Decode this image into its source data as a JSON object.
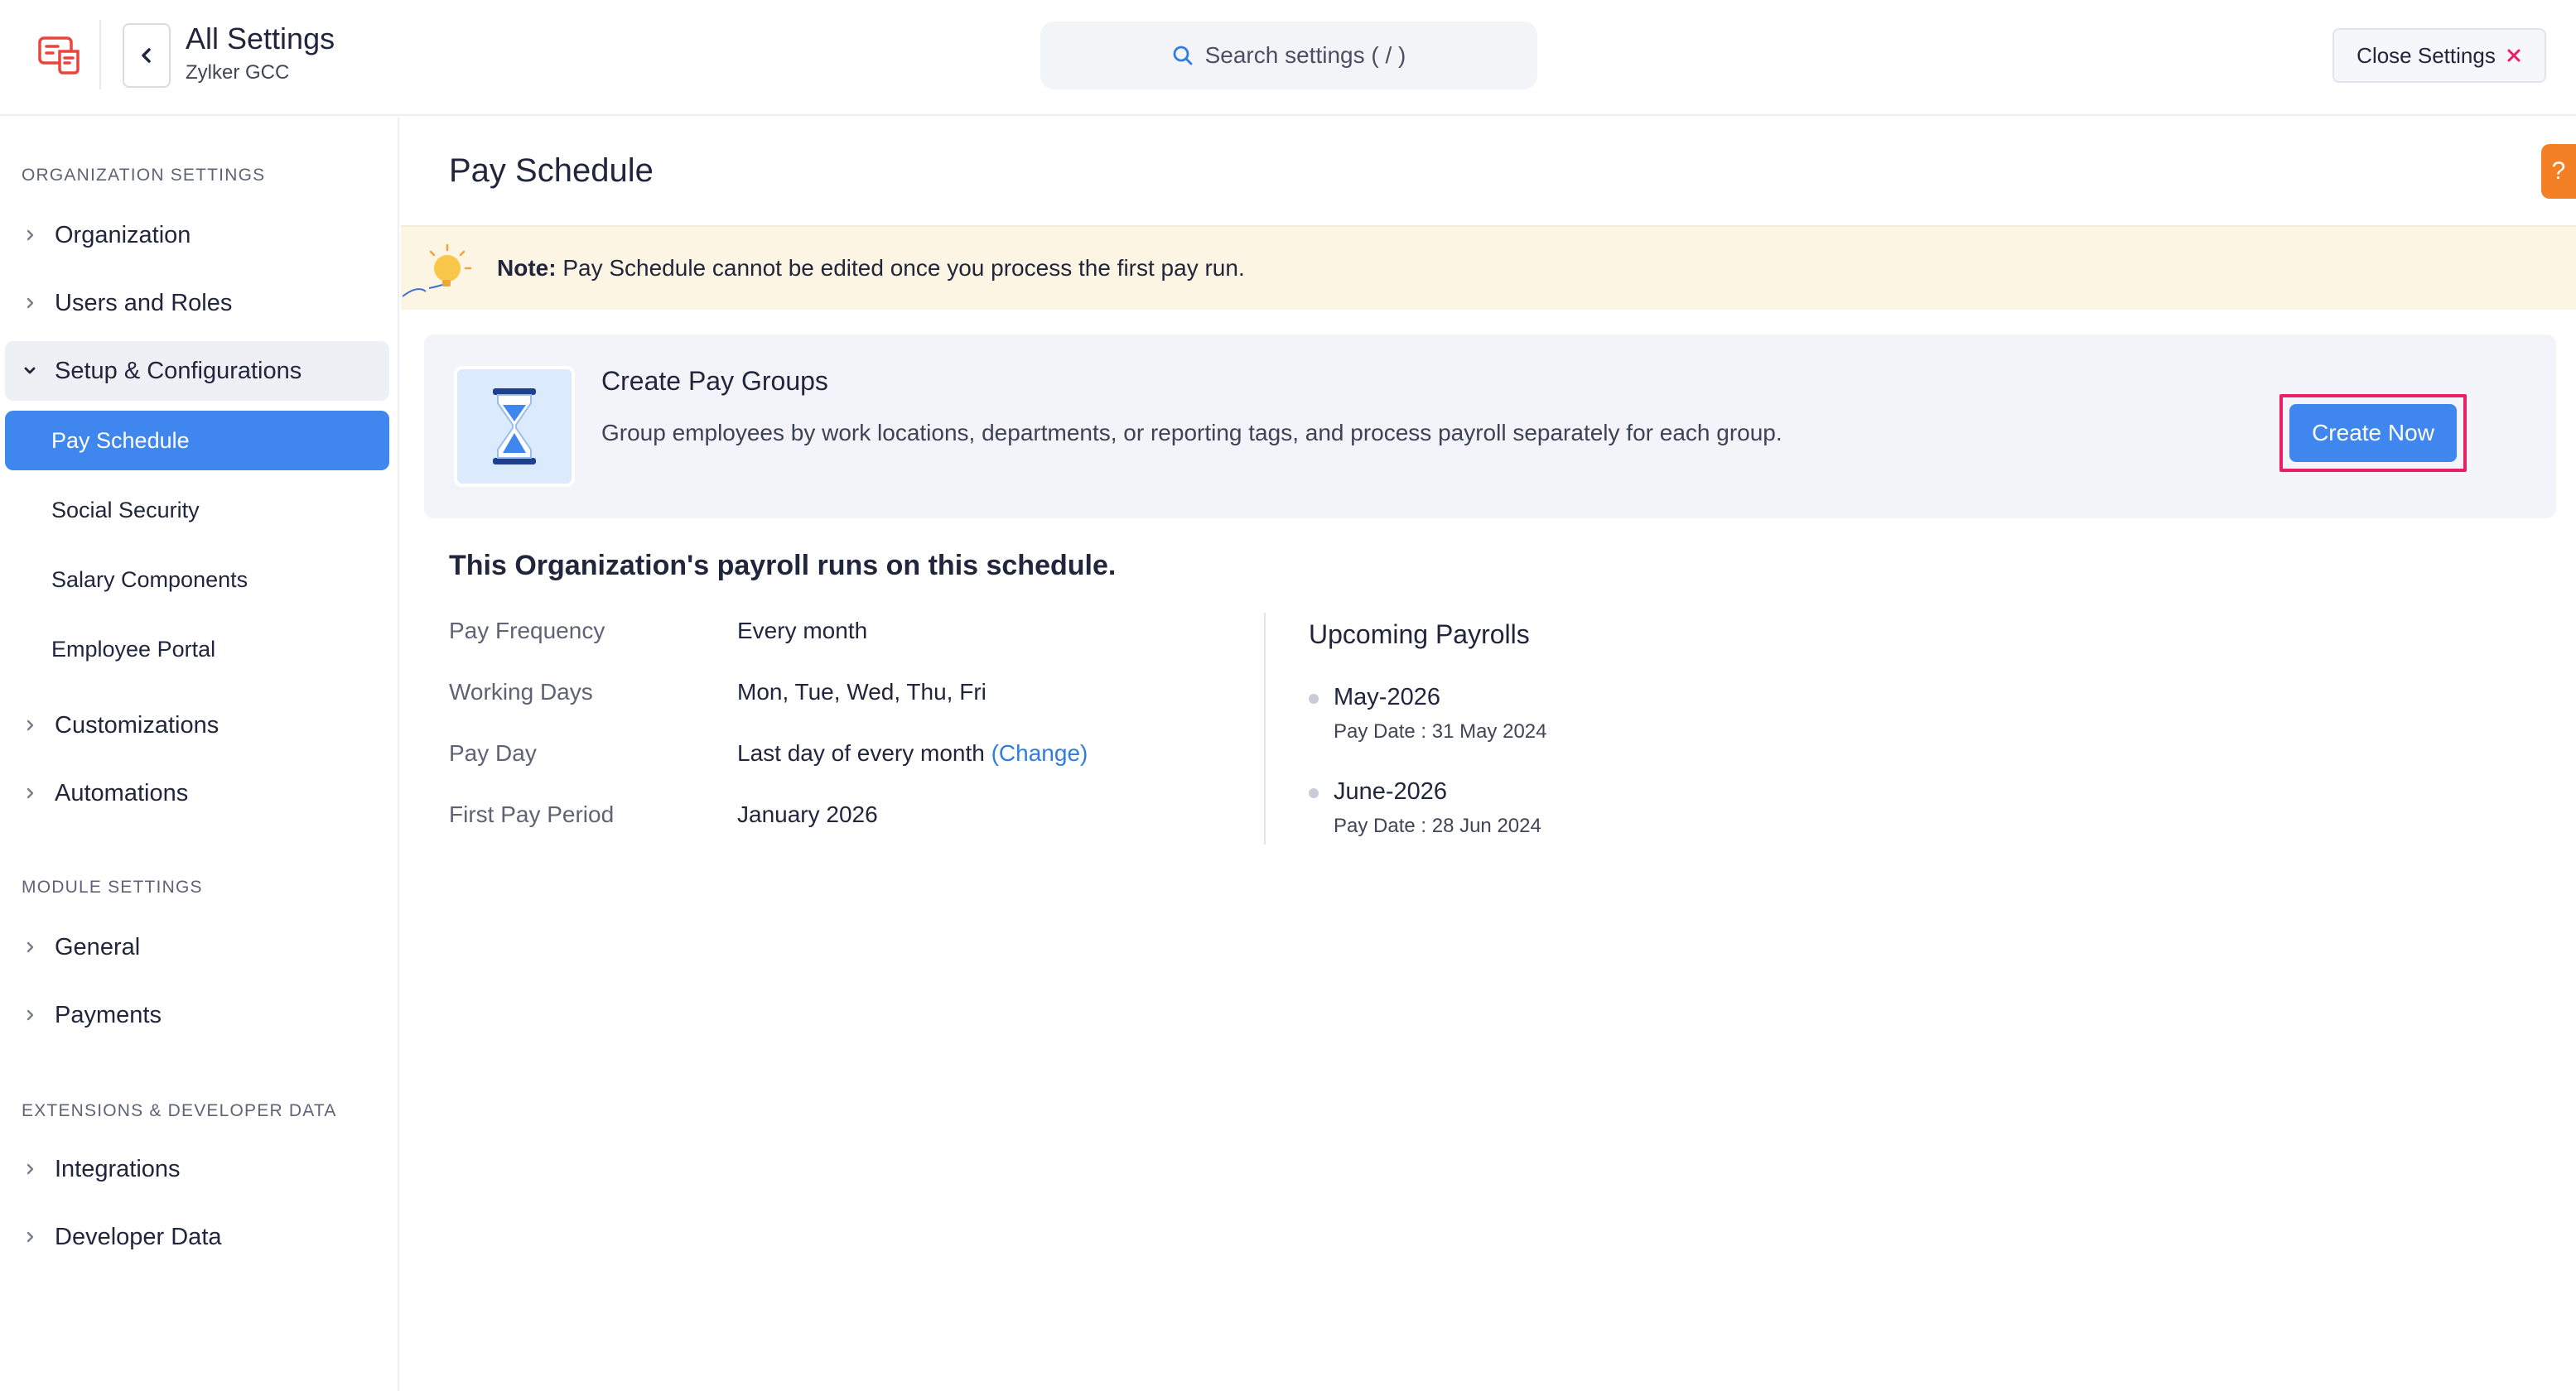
{
  "header": {
    "title": "All Settings",
    "org_name": "Zylker GCC",
    "search_placeholder": "Search settings ( / )",
    "close_label": "Close Settings"
  },
  "sidebar": {
    "sections": [
      {
        "title": "ORGANIZATION SETTINGS"
      },
      {
        "title": "MODULE SETTINGS"
      },
      {
        "title": "EXTENSIONS & DEVELOPER DATA"
      }
    ],
    "items": [
      {
        "label": "Organization",
        "icon": "chevron-right-icon"
      },
      {
        "label": "Users and Roles",
        "icon": "chevron-right-icon"
      },
      {
        "label": "Setup & Configurations",
        "icon": "chevron-down-icon",
        "expanded": true
      },
      {
        "label": "Customizations",
        "icon": "chevron-right-icon"
      },
      {
        "label": "Automations",
        "icon": "chevron-right-icon"
      },
      {
        "label": "General",
        "icon": "chevron-right-icon"
      },
      {
        "label": "Payments",
        "icon": "chevron-right-icon"
      },
      {
        "label": "Integrations",
        "icon": "chevron-right-icon"
      },
      {
        "label": "Developer Data",
        "icon": "chevron-right-icon"
      }
    ],
    "sub_items": [
      {
        "label": "Pay Schedule",
        "active": true
      },
      {
        "label": "Social Security"
      },
      {
        "label": "Salary Components"
      },
      {
        "label": "Employee Portal"
      }
    ]
  },
  "main": {
    "page_title": "Pay Schedule",
    "help_label": "?",
    "note": {
      "prefix": "Note:",
      "text": " Pay Schedule cannot be edited once you process the first pay run."
    },
    "pay_groups": {
      "title": "Create Pay Groups",
      "description": "Group employees by work locations, departments, or reporting tags, and process payroll separately for each group.",
      "button_label": "Create Now"
    },
    "schedule": {
      "heading": "This Organization's payroll runs on this schedule.",
      "rows": [
        {
          "label": "Pay Frequency",
          "value": "Every month"
        },
        {
          "label": "Working Days",
          "value": "Mon, Tue, Wed, Thu, Fri"
        },
        {
          "label": "Pay Day",
          "value": "Last day of every month",
          "link": "(Change)"
        },
        {
          "label": "First Pay Period",
          "value": "January 2026"
        }
      ]
    },
    "upcoming": {
      "title": "Upcoming Payrolls",
      "items": [
        {
          "month": "May-2026",
          "pay_date": "Pay Date : 31 May 2024"
        },
        {
          "month": "June-2026",
          "pay_date": "Pay Date : 28 Jun 2024"
        }
      ]
    }
  },
  "colors": {
    "accent": "#3f86ef",
    "note_background": "#fdf5e3",
    "highlight": "#e91e63",
    "help_tab": "#f38025",
    "logo": "#e8453c"
  }
}
